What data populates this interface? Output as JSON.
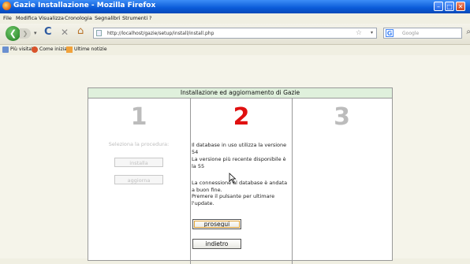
{
  "window": {
    "title": "Gazie Installazione - Mozilla Firefox",
    "minimize": "–",
    "maximize": "□",
    "close": "✕"
  },
  "menu": [
    "File",
    "Modifica",
    "Visualizza",
    "Cronologia",
    "Segnalibri",
    "Strumenti",
    "?"
  ],
  "nav": {
    "back": "❮",
    "forward": "❯",
    "dropdown": "▾",
    "reload": "C",
    "stop": "✕",
    "home": "⌂",
    "url": "http://localhost/gazie/setup/install/install.php",
    "bookmark_star": "☆",
    "url_dropdown": "▾",
    "search_engine": "G",
    "search_placeholder": "Google",
    "search_icon": "⌕"
  },
  "bookmarks": [
    "Più visitati",
    "Come iniziare",
    "Ultime notizie"
  ],
  "panel": {
    "header": "Installazione ed aggiornamento di Gazie",
    "steps": [
      "1",
      "2",
      "3"
    ],
    "step1": {
      "label": "Seleziona la procedura:",
      "install_button": "installa",
      "update_button": "aggiorna"
    },
    "step2": {
      "version_msg": "Il database in uso utilizza la versione 54",
      "latest_msg": "La versione più recente disponibile è la 55",
      "connection_msg": "La connessione al database è andata a buon fine.",
      "instruction_msg": "Premere il pulsante per ultimare l'update.",
      "continue_button": "prosegui",
      "back_button": "indietro"
    }
  },
  "colors": {
    "titlebar": "#0a5ad8",
    "panel_header": "#dff0dc",
    "active_step": "#e01010",
    "inactive_step": "#bcbcbc"
  }
}
